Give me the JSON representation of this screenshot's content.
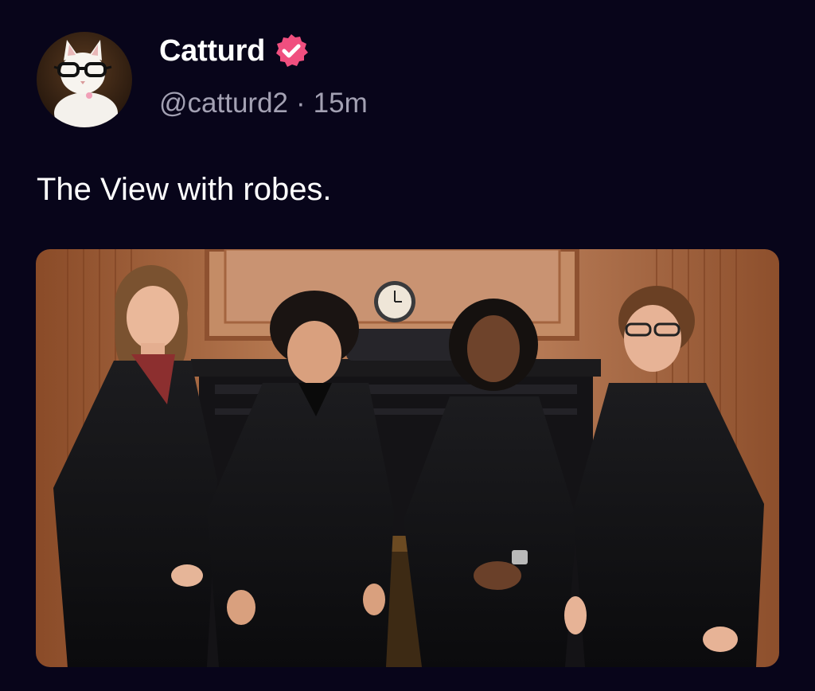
{
  "author": {
    "display_name": "Catturd",
    "handle": "@catturd2",
    "separator": "·",
    "timestamp": "15m",
    "verified_badge_color": "#f04f7f",
    "avatar_icon": "cat-with-glasses-avatar"
  },
  "post": {
    "text": "The View with robes."
  },
  "media": {
    "kind": "photo",
    "icon": "photo-four-robed-justices"
  },
  "colors": {
    "background": "#08051a",
    "text_primary": "#ffffff",
    "text_secondary": "#a3a1b3"
  }
}
